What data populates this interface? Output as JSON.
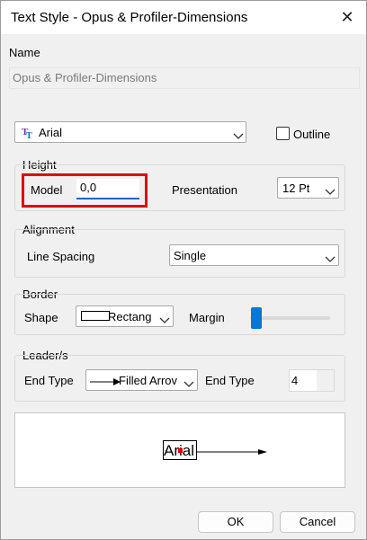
{
  "window": {
    "title": "Text Style - Opus & Profiler-Dimensions",
    "close_symbol": "✕"
  },
  "name": {
    "label": "Name",
    "value": "Opus & Profiler-Dimensions"
  },
  "font": {
    "value": "Arial",
    "icon": "font-icon",
    "outline_label": "Outline",
    "outline_checked": false
  },
  "height": {
    "group_label": "Height",
    "model_label": "Model",
    "model_value": "0,0",
    "presentation_label": "Presentation",
    "presentation_value": "12 Pt"
  },
  "alignment": {
    "group_label": "Alignment",
    "line_spacing_label": "Line Spacing",
    "line_spacing_value": "Single"
  },
  "border": {
    "group_label": "Border",
    "shape_label": "Shape",
    "shape_value": "Rectang",
    "margin_label": "Margin",
    "margin_level": 0.05
  },
  "leader": {
    "group_label": "Leader/s",
    "end_type_label": "End Type",
    "end_type_value": "Filled Arrov",
    "end_type2_label": "End Type",
    "end_type2_value": "4"
  },
  "preview": {
    "sample_text": "Arial"
  },
  "buttons": {
    "ok": "OK",
    "cancel": "Cancel"
  },
  "colors": {
    "accent": "#0078d4",
    "highlight": "#e00000"
  }
}
